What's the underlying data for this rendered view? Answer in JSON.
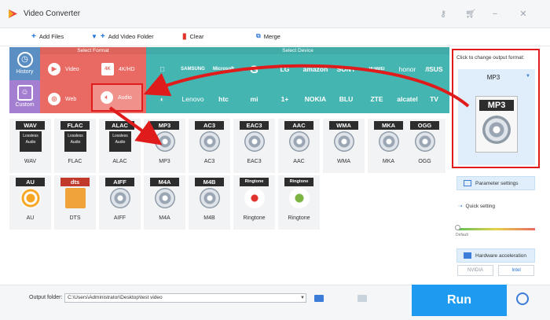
{
  "app": {
    "title": "Video Converter"
  },
  "toolbar": {
    "add_files": "Add Files",
    "add_video_folder": "Add Video Folder",
    "clear": "Clear",
    "merge": "Merge"
  },
  "categories": {
    "history": "History",
    "custom": "Custom"
  },
  "format_panel": {
    "header": "Select Format",
    "items": [
      "Video",
      "4K/HD",
      "Web",
      "Audio"
    ]
  },
  "device_panel": {
    "header": "Select Device",
    "row1": [
      "",
      "SAMSUNG",
      "Microsoft",
      "G",
      "LG",
      "amazon",
      "SONY",
      "HUAWEI",
      "honor",
      "/ISUS"
    ],
    "row2": [
      "◐",
      "Lenovo",
      "htc",
      "mi",
      "1+",
      "NOKIA",
      "BLU",
      "ZTE",
      "alcatel",
      "TV"
    ]
  },
  "formats": {
    "row1": [
      {
        "badge": "WAV",
        "name": "WAV"
      },
      {
        "badge": "FLAC",
        "name": "FLAC"
      },
      {
        "badge": "ALAC",
        "name": "ALAC"
      },
      {
        "badge": "MP3",
        "name": "MP3"
      },
      {
        "badge": "AC3",
        "name": "AC3"
      },
      {
        "badge": "EAC3",
        "name": "EAC3"
      },
      {
        "badge": "AAC",
        "name": "AAC"
      },
      {
        "badge": "WMA",
        "name": "WMA"
      },
      {
        "badge": "MKA",
        "name": "MKA"
      },
      {
        "badge": "OGG",
        "name": "OGG"
      }
    ],
    "row2": [
      {
        "badge": "AU",
        "name": "AU"
      },
      {
        "badge": "dts",
        "name": "DTS"
      },
      {
        "badge": "AIFF",
        "name": "AIFF"
      },
      {
        "badge": "M4A",
        "name": "M4A"
      },
      {
        "badge": "M4B",
        "name": "M4B"
      },
      {
        "badge": "Ringtone",
        "name": "Ringtone"
      },
      {
        "badge": "Ringtone",
        "name": "Ringtone"
      }
    ],
    "lossless_text": "Lossless Audio"
  },
  "output_panel": {
    "title": "Click to change output format:",
    "selected": "MP3",
    "badge": "MP3"
  },
  "side": {
    "parameter_settings": "Parameter settings",
    "quick_setting": "Quick setting",
    "default_label": "Default",
    "hardware_acceleration": "Hardware acceleration",
    "nvidia": "NVIDIA",
    "intel": "Intel"
  },
  "bottom": {
    "output_folder_label": "Output folder:",
    "output_folder_value": "C:\\Users\\Administrator\\Desktop\\test video",
    "run": "Run"
  },
  "colors": {
    "accent": "#1e9bf0",
    "format_panel": "#e96a63",
    "device_panel": "#45b5b1",
    "highlight": "#e01b1b"
  }
}
